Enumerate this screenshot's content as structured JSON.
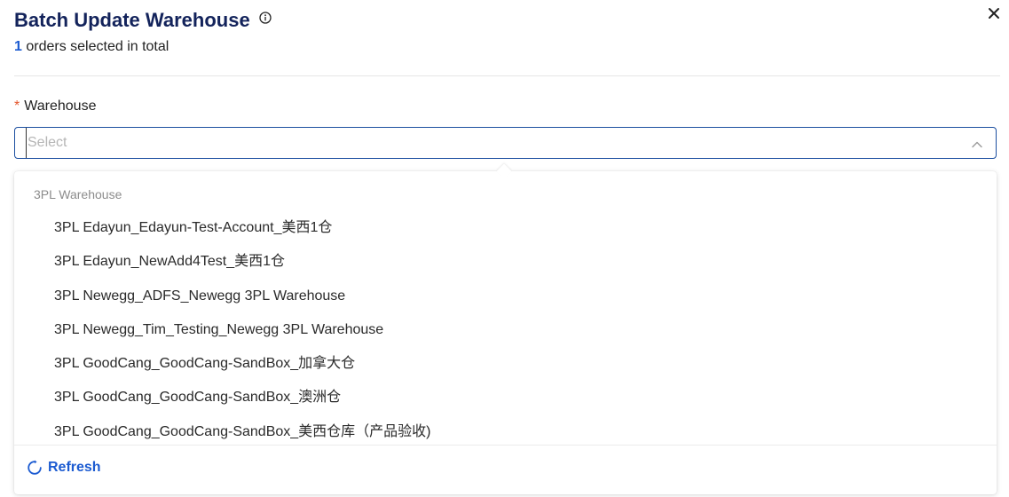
{
  "header": {
    "title": "Batch Update Warehouse",
    "selected_count": "1",
    "selected_suffix": " orders selected in total"
  },
  "form": {
    "required_mark": "*",
    "warehouse_label": "Warehouse",
    "warehouse_placeholder": "Select",
    "warehouse_value": ""
  },
  "dropdown": {
    "group_label": "3PL Warehouse",
    "options": [
      "3PL Edayun_Edayun-Test-Account_美西1仓",
      "3PL Edayun_NewAdd4Test_美西1仓",
      "3PL Newegg_ADFS_Newegg 3PL Warehouse",
      "3PL Newegg_Tim_Testing_Newegg 3PL Warehouse",
      "3PL GoodCang_GoodCang-SandBox_加拿大仓",
      "3PL GoodCang_GoodCang-SandBox_澳洲仓",
      "3PL GoodCang_GoodCang-SandBox_美西仓库（产品验收)"
    ],
    "refresh_label": "Refresh"
  },
  "icons": {
    "info": "info-icon",
    "close": "close-icon",
    "chevron": "chevron-up-icon",
    "refresh": "refresh-icon"
  },
  "colors": {
    "title": "#13235b",
    "accent": "#1c5bd1",
    "required": "#e4572e",
    "input_border": "#1c4fa0"
  }
}
